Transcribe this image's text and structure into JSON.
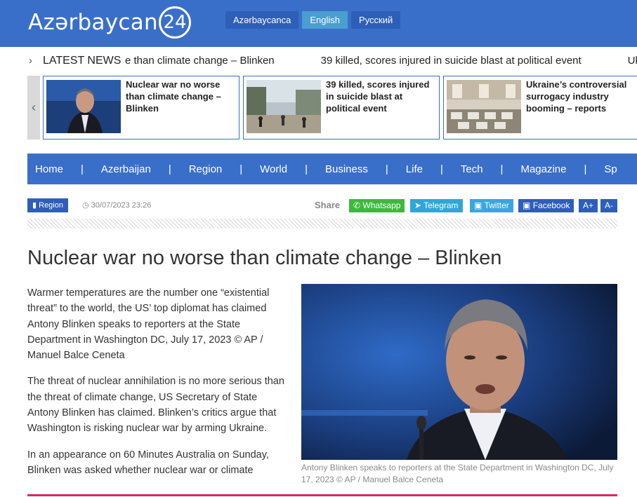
{
  "header": {
    "logo_text": "Azərbaycan",
    "logo_number": "24",
    "languages": [
      {
        "label": "Azərbaycanca",
        "active": false
      },
      {
        "label": "English",
        "active": true
      },
      {
        "label": "Русский",
        "active": false
      }
    ]
  },
  "ticker": {
    "label": "LATEST NEWS",
    "items": [
      "e than climate change – Blinken",
      "39 killed, scores injured in suicide blast at political event",
      "Uk"
    ]
  },
  "featured": [
    {
      "title": "Nuclear war no worse than climate change – Blinken"
    },
    {
      "title": "39 killed, scores injured in suicide blast at political event"
    },
    {
      "title": "Ukraine’s controversial surrogacy industry booming – reports"
    }
  ],
  "nav": [
    "Home",
    "Azerbaijan",
    "Region",
    "World",
    "Business",
    "Life",
    "Tech",
    "Magazine",
    "Sp"
  ],
  "article": {
    "category": "Region",
    "date": "30/07/2023 23:26",
    "share_label": "Share",
    "share_buttons": [
      {
        "label": "Whatsapp",
        "color": "#3cb93c",
        "icon": "whatsapp-icon"
      },
      {
        "label": "Telegram",
        "color": "#2ea7d8",
        "icon": "telegram-icon"
      },
      {
        "label": "Twitter",
        "color": "#3aa6e0",
        "icon": "twitter-icon"
      },
      {
        "label": "Facebook",
        "color": "#2d5fb8",
        "icon": "facebook-icon"
      },
      {
        "label": "A+",
        "color": "#2d5fb8"
      },
      {
        "label": "A-",
        "color": "#2d5fb8"
      }
    ],
    "headline": "Nuclear war no worse than climate change – Blinken",
    "paragraphs": [
      "Warmer temperatures are the number one “existential threat” to the world, the US’ top diplomat has claimed Antony Blinken speaks to reporters at the State Department in Washington DC, July 17, 2023 © AP / Manuel Balce Ceneta",
      "The threat of nuclear annihilation is no more serious than the threat of climate change, US Secretary of State Antony Blinken has claimed. Blinken’s critics argue that Washington is risking nuclear war by arming Ukraine.",
      "In an appearance on 60 Minutes Australia on Sunday, Blinken was asked whether nuclear war or climate"
    ],
    "caption": "Antony Blinken speaks to reporters at the State Department in Washington DC, July 17, 2023 ©  AP / Manuel Balce Ceneta"
  },
  "colors": {
    "brand_blue": "#3a6fc9",
    "active_lang": "#4a9ed0",
    "accent_red": "#e0245e"
  }
}
